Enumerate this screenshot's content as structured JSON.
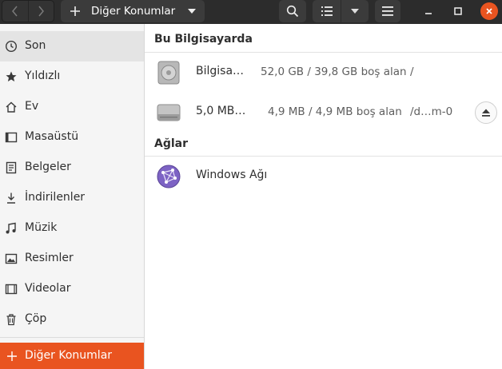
{
  "header": {
    "path_label": "Diğer Konumlar",
    "icons": {
      "back": "chevron-left-icon",
      "forward": "chevron-right-icon",
      "add": "plus-icon",
      "search": "search-icon",
      "view": "list-view-icon",
      "menu": "hamburger-menu-icon"
    }
  },
  "sidebar": {
    "items": [
      {
        "label": "Son",
        "icon": "clock-icon",
        "active": true
      },
      {
        "label": "Yıldızlı",
        "icon": "star-icon"
      },
      {
        "label": "Ev",
        "icon": "home-icon"
      },
      {
        "label": "Masaüstü",
        "icon": "desktop-icon"
      },
      {
        "label": "Belgeler",
        "icon": "document-icon"
      },
      {
        "label": "İndirilenler",
        "icon": "download-icon"
      },
      {
        "label": "Müzik",
        "icon": "music-icon"
      },
      {
        "label": "Resimler",
        "icon": "picture-icon"
      },
      {
        "label": "Videolar",
        "icon": "video-icon"
      },
      {
        "label": "Çöp",
        "icon": "trash-icon"
      }
    ],
    "other_locations": "Diğer Konumlar"
  },
  "main": {
    "computer_section": "Bu Bilgisayarda",
    "drives": [
      {
        "name": "Bilgisa…",
        "space": "52,0 GB / 39,8 GB boş alan",
        "path": "/"
      },
      {
        "name": "5,0 MB…",
        "space": "4,9 MB / 4,9 MB boş alan",
        "path": "/d…m-0"
      }
    ],
    "network_section": "Ağlar",
    "networks": [
      {
        "name": "Windows Ağı"
      }
    ]
  },
  "colors": {
    "accent": "#e95420",
    "header_bg": "#2c2c2c",
    "sidebar_bg": "#f5f5f5"
  }
}
